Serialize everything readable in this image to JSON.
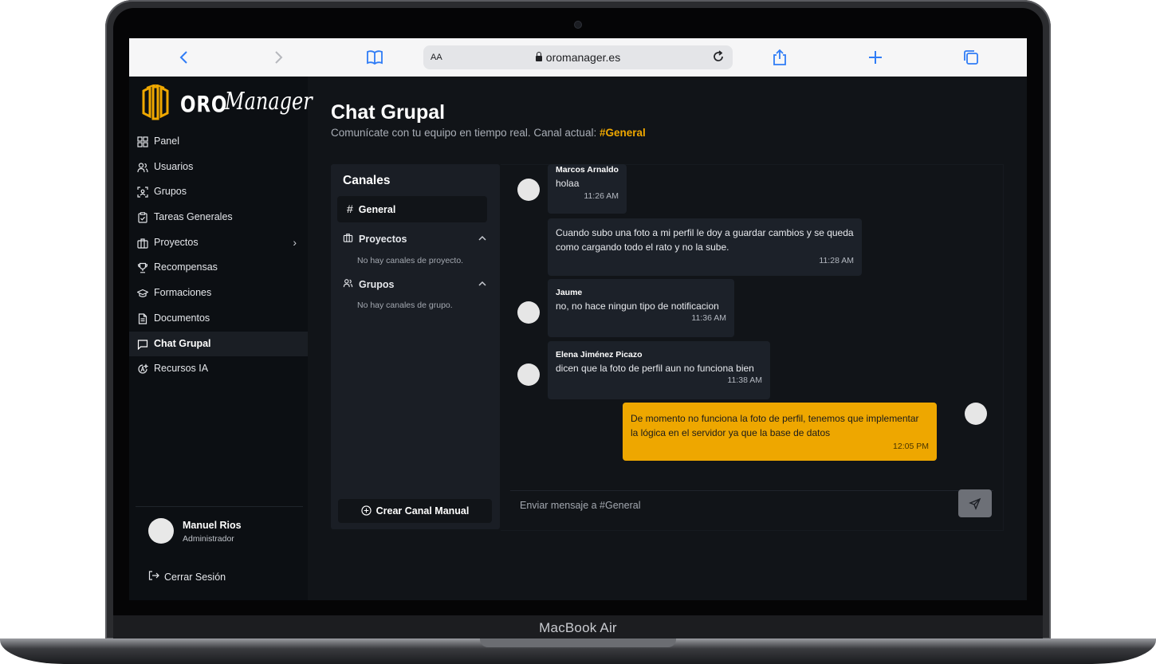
{
  "device": {
    "brand": "MacBook Air"
  },
  "browser": {
    "aa_label": "AA",
    "url": "oromanager.es"
  },
  "logo": {
    "oro": "ORO",
    "manager": "Manager"
  },
  "sidebar": {
    "items": [
      {
        "label": "Panel",
        "icon": "grid-icon"
      },
      {
        "label": "Usuarios",
        "icon": "users-icon"
      },
      {
        "label": "Grupos",
        "icon": "group-scan-icon"
      },
      {
        "label": "Tareas Generales",
        "icon": "clipboard-check-icon"
      },
      {
        "label": "Proyectos",
        "icon": "briefcase-icon"
      },
      {
        "label": "Recompensas",
        "icon": "trophy-icon"
      },
      {
        "label": "Formaciones",
        "icon": "graduation-cap-icon"
      },
      {
        "label": "Documentos",
        "icon": "document-icon"
      },
      {
        "label": "Chat Grupal",
        "icon": "chat-icon"
      },
      {
        "label": "Recursos IA",
        "icon": "ai-icon"
      }
    ],
    "active": "Chat Grupal",
    "user": {
      "name": "Manuel Rios",
      "role": "Administrador"
    },
    "logout_label": "Cerrar Sesión"
  },
  "page": {
    "title": "Chat Grupal",
    "subtitle_prefix": "Comunícate con tu equipo en tiempo real. Canal actual: ",
    "current_channel": "#General"
  },
  "channels": {
    "title": "Canales",
    "general_label": "General",
    "projects_label": "Proyectos",
    "projects_empty": "No hay canales de proyecto.",
    "groups_label": "Grupos",
    "groups_empty": "No hay canales de grupo.",
    "create_label": "Crear Canal Manual"
  },
  "messages": [
    {
      "author": "Marcos Arnaldo",
      "text": "holaa",
      "time": "11:26 AM"
    },
    {
      "author": "",
      "text": "Cuando subo una foto a mi perfil le doy a guardar cambios y se queda como cargando todo el rato y no la sube.",
      "time": "11:28 AM"
    },
    {
      "author": "Jaume",
      "text": "no, no hace ningun tipo de notificacion",
      "time": "11:36 AM"
    },
    {
      "author": "Elena Jiménez Picazo",
      "text": "dicen que la foto de perfil aun no funciona bien",
      "time": "11:38 AM"
    },
    {
      "author": "",
      "text": "De momento no funciona la foto de perfil, tenemos que implementar la lógica en el servidor ya que la base de datos",
      "time": "12:05 PM"
    }
  ],
  "composer": {
    "placeholder": "Enviar mensaje a #General"
  },
  "colors": {
    "accent": "#eea700",
    "background": "#111418",
    "sidebar": "#0c0f13"
  }
}
